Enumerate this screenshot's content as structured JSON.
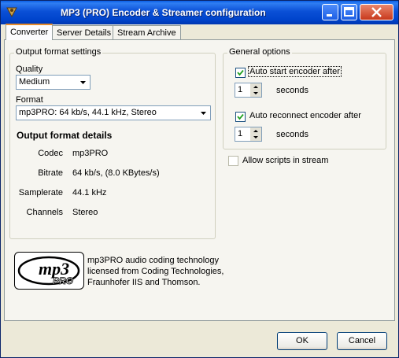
{
  "window": {
    "title": "MP3 (PRO) Encoder & Streamer configuration"
  },
  "tabs": [
    {
      "label": "Converter",
      "active": true
    },
    {
      "label": "Server Details",
      "active": false
    },
    {
      "label": "Stream Archive",
      "active": false
    }
  ],
  "output_settings": {
    "group_label": "Output format settings",
    "quality_label": "Quality",
    "quality_value": "Medium",
    "format_label": "Format",
    "format_value": "mp3PRO: 64 kb/s, 44.1 kHz, Stereo"
  },
  "details": {
    "heading": "Output format details",
    "rows": [
      {
        "label": "Codec",
        "value": "mp3PRO"
      },
      {
        "label": "Bitrate",
        "value": "64 kb/s, (8.0 KBytes/s)"
      },
      {
        "label": "Samplerate",
        "value": "44.1 kHz"
      },
      {
        "label": "Channels",
        "value": "Stereo"
      }
    ]
  },
  "general": {
    "group_label": "General options",
    "auto_start_label": "Auto start encoder after",
    "auto_start_checked": true,
    "auto_start_value": "1",
    "auto_start_unit": "seconds",
    "auto_reconnect_label": "Auto reconnect encoder after",
    "auto_reconnect_checked": true,
    "auto_reconnect_value": "1",
    "auto_reconnect_unit": "seconds",
    "allow_scripts_label": "Allow scripts in stream",
    "allow_scripts_checked": false
  },
  "logo": {
    "text_main": "mp3",
    "text_sub": "PRO"
  },
  "license": {
    "line1": "mp3PRO audio coding technology",
    "line2": "licensed from Coding Technologies,",
    "line3": "Fraunhofer IIS and Thomson."
  },
  "buttons": {
    "ok": "OK",
    "cancel": "Cancel"
  },
  "colors": {
    "titlebar": "#0054e3",
    "window_bg": "#ece9d8",
    "tab_highlight": "#e68b2c"
  }
}
